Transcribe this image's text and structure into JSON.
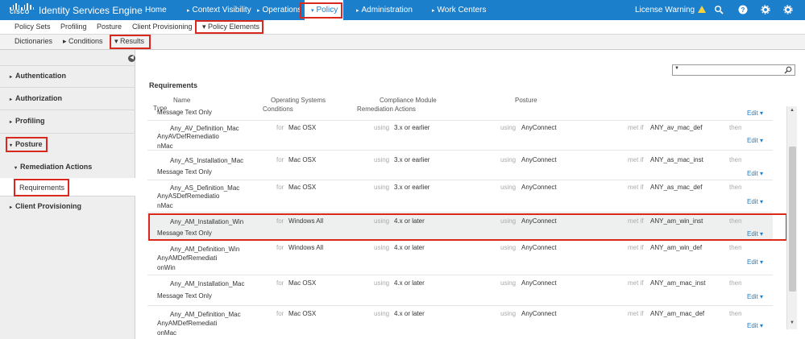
{
  "app": {
    "brand": "CISCO",
    "title": "Identity Services Engine"
  },
  "topnav": [
    {
      "label": "Home",
      "arrow": ""
    },
    {
      "label": "Context Visibility",
      "arrow": "▸"
    },
    {
      "label": "Operations",
      "arrow": "▸"
    },
    {
      "label": "Policy",
      "arrow": "▾",
      "active": true
    },
    {
      "label": "Administration",
      "arrow": "▸"
    },
    {
      "label": "Work Centers",
      "arrow": "▸"
    }
  ],
  "license_warning": "License Warning",
  "subnav": [
    "Policy Sets",
    "Profiling",
    "Posture",
    "Client Provisioning",
    "▾ Policy Elements"
  ],
  "thirdnav": [
    "Dictionaries",
    "▸ Conditions",
    "▾ Results"
  ],
  "sidebar": {
    "items": [
      {
        "label": "Authentication",
        "tri": "▸"
      },
      {
        "label": "Authorization",
        "tri": "▸"
      },
      {
        "label": "Profiling",
        "tri": "▸"
      },
      {
        "label": "Posture",
        "tri": "▾"
      },
      {
        "label": "Remediation Actions",
        "tri": "▾"
      },
      {
        "label": "Requirements",
        "tri": ""
      },
      {
        "label": "Client Provisioning",
        "tri": "▸"
      }
    ]
  },
  "main": {
    "title": "Requirements",
    "headers": {
      "name": "Name",
      "os": "Operating Systems",
      "compliance": "Compliance Module",
      "posture": "Posture",
      "type": "Type",
      "conditions": "Conditions",
      "remediation": "Remediation Actions"
    },
    "labels": {
      "for": "for",
      "using": "using",
      "metif": "met if",
      "then": "then",
      "edit": "Edit"
    },
    "first_partial": "Message Text Only",
    "rows": [
      {
        "name": "Any_AV_Definition_Mac",
        "os": "Mac OSX",
        "module": "3.x or earlier",
        "posture": "AnyConnect",
        "condition": "ANY_av_mac_def",
        "remediation": "AnyAVDefRemediationMac"
      },
      {
        "name": "Any_AS_Installation_Mac",
        "os": "Mac OSX",
        "module": "3.x or earlier",
        "posture": "AnyConnect",
        "condition": "ANY_as_mac_inst",
        "remediation": "Message Text Only"
      },
      {
        "name": "Any_AS_Definition_Mac",
        "os": "Mac OSX",
        "module": "3.x or earlier",
        "posture": "AnyConnect",
        "condition": "ANY_as_mac_def",
        "remediation": "AnyASDefRemediationMac"
      },
      {
        "name": "Any_AM_Installation_Win",
        "os": "Windows All",
        "module": "4.x or later",
        "posture": "AnyConnect",
        "condition": "ANY_am_win_inst",
        "remediation": "Message Text Only",
        "highlight": true
      },
      {
        "name": "Any_AM_Definition_Win",
        "os": "Windows All",
        "module": "4.x or later",
        "posture": "AnyConnect",
        "condition": "ANY_am_win_def",
        "remediation": "AnyAMDefRemediationWin"
      },
      {
        "name": "Any_AM_Installation_Mac",
        "os": "Mac OSX",
        "module": "4.x or later",
        "posture": "AnyConnect",
        "condition": "ANY_am_mac_inst",
        "remediation": "Message Text Only"
      },
      {
        "name": "Any_AM_Definition_Mac",
        "os": "Mac OSX",
        "module": "4.x or later",
        "posture": "AnyConnect",
        "condition": "ANY_am_mac_def",
        "remediation": "AnyAMDefRemediationMac"
      }
    ]
  },
  "colors": {
    "topbar": "#1b7fcc",
    "highlight_border": "#d9281e",
    "link": "#1b7fcc"
  }
}
